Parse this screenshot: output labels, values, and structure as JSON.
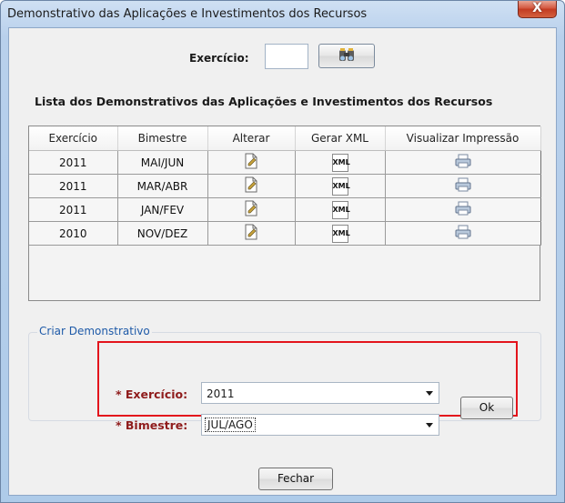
{
  "window": {
    "title": "Demonstrativo das Aplicações e Investimentos dos Recursos",
    "close_glyph": "X"
  },
  "filter": {
    "label": "Exercício:",
    "value": ""
  },
  "list": {
    "title": "Lista dos Demonstrativos das Aplicações e Investimentos dos Recursos",
    "columns": [
      "Exercício",
      "Bimestre",
      "Alterar",
      "Gerar XML",
      "Visualizar Impressão"
    ],
    "rows": [
      {
        "exercicio": "2011",
        "bimestre": "MAI/JUN"
      },
      {
        "exercicio": "2011",
        "bimestre": "MAR/ABR"
      },
      {
        "exercicio": "2011",
        "bimestre": "JAN/FEV"
      },
      {
        "exercicio": "2010",
        "bimestre": "NOV/DEZ"
      }
    ],
    "xml_glyph": "XML"
  },
  "criar": {
    "legend": "Criar Demonstrativo",
    "exercicio_label": "* Exercício:",
    "exercicio_value": "2011",
    "bimestre_label": "* Bimestre:",
    "bimestre_value": "JUL/AGO",
    "ok_label": "Ok"
  },
  "footer": {
    "close_label": "Fechar"
  },
  "colors": {
    "highlight_border": "#e3141c",
    "legend": "#1e5aa8",
    "required_label": "#8f1c1c"
  }
}
